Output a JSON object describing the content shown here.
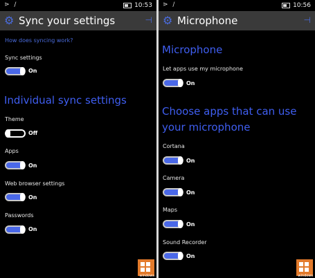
{
  "left": {
    "status": {
      "signal": "⋗ ∕",
      "time": "10:53"
    },
    "header": {
      "title": "Sync your settings"
    },
    "link": "How does syncing work?",
    "sync_settings": {
      "label": "Sync settings",
      "state": "On"
    },
    "section_title": "Individual sync settings",
    "items": [
      {
        "label": "Theme",
        "state": "Off"
      },
      {
        "label": "Apps",
        "state": "On"
      },
      {
        "label": "Web browser settings",
        "state": "On"
      },
      {
        "label": "Passwords",
        "state": "On"
      }
    ]
  },
  "right": {
    "status": {
      "signal": "⋗ ∕",
      "time": "10:56"
    },
    "header": {
      "title": "Microphone"
    },
    "section_title": "Microphone",
    "let_apps": {
      "label": "Let apps use my microphone",
      "state": "On"
    },
    "apps_title": "Choose apps that can use your microphone",
    "apps": [
      {
        "label": "Cortana",
        "state": "On"
      },
      {
        "label": "Camera",
        "state": "On"
      },
      {
        "label": "Maps",
        "state": "On"
      },
      {
        "label": "Sound Recorder",
        "state": "On"
      }
    ]
  },
  "watermark": {
    "text": "windows"
  },
  "colors": {
    "accent": "#4a68e8",
    "header_bg": "#3a3a3a",
    "watermark": "#e27a2b"
  }
}
